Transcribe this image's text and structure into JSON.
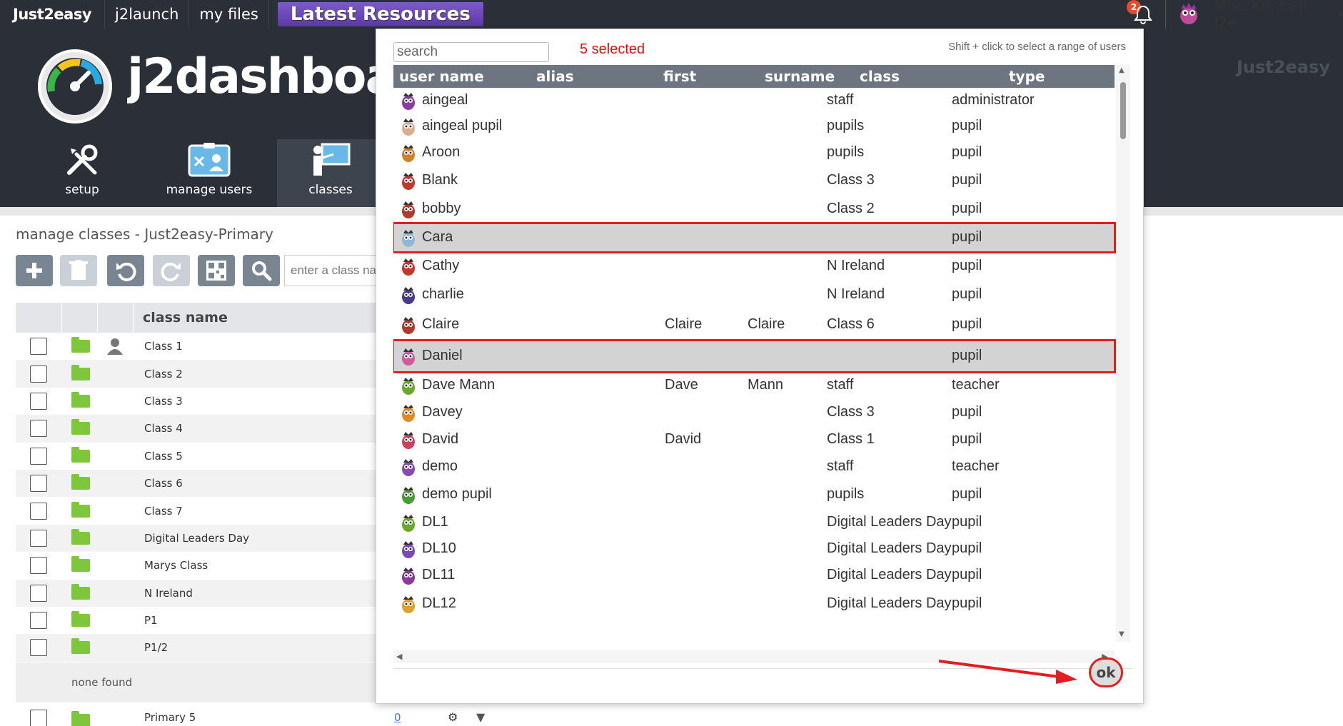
{
  "topbar": {
    "brand": "Just2easy",
    "links": [
      "j2launch",
      "my files"
    ],
    "latest": "Latest Resources",
    "notifications": "2",
    "user": "Miss Kimbell J2e"
  },
  "banner": {
    "logo_text": "j2dashboard",
    "watermark": "Just2easy",
    "tabs": [
      {
        "label": "setup",
        "icon": "wrench-screwdriver-icon"
      },
      {
        "label": "manage users",
        "icon": "users-card-icon"
      },
      {
        "label": "classes",
        "icon": "teacher-board-icon"
      }
    ]
  },
  "page": {
    "title": "manage classes - Just2easy-Primary",
    "class_search_placeholder": "enter a class na"
  },
  "class_table": {
    "header": "class name",
    "rows": [
      "Class 1",
      "Class 2",
      "Class 3",
      "Class 4",
      "Class 5",
      "Class 6",
      "Class 7",
      "Digital Leaders Day",
      "Marys Class",
      "N Ireland",
      "P1",
      "P1/2"
    ],
    "none_found": "none found",
    "extra_row": {
      "name": "Primary 5",
      "count": "0"
    }
  },
  "modal": {
    "search_placeholder": "search",
    "selected_text": "5 selected",
    "hint": "Shift + click to select a range of users",
    "columns": [
      "user name",
      "alias",
      "first",
      "surname",
      "class",
      "type"
    ],
    "users": [
      {
        "name": "aingeal",
        "first": "",
        "surname": "",
        "class": "staff",
        "type": "administrator",
        "selected": false,
        "color": "#8a3fa0"
      },
      {
        "name": "aingeal pupil",
        "first": "",
        "surname": "",
        "class": "pupils",
        "type": "pupil",
        "selected": false,
        "color": "#d8b090"
      },
      {
        "name": "Aroon",
        "first": "",
        "surname": "",
        "class": "pupils",
        "type": "pupil",
        "selected": false,
        "color": "#d0822a"
      },
      {
        "name": "Blank",
        "first": "",
        "surname": "",
        "class": "Class 3",
        "type": "pupil",
        "selected": false,
        "color": "#c0392b"
      },
      {
        "name": "bobby",
        "first": "",
        "surname": "",
        "class": "Class 2",
        "type": "pupil",
        "selected": false,
        "color": "#b03a2e"
      },
      {
        "name": "Cara",
        "first": "",
        "surname": "",
        "class": "",
        "type": "pupil",
        "selected": true,
        "color": "#8fb8d8"
      },
      {
        "name": "Cathy",
        "first": "",
        "surname": "",
        "class": "N Ireland",
        "type": "pupil",
        "selected": false,
        "color": "#c0392b"
      },
      {
        "name": "charlie",
        "first": "",
        "surname": "",
        "class": "N Ireland",
        "type": "pupil",
        "selected": false,
        "color": "#4a3a8a"
      },
      {
        "name": "Claire",
        "first": "Claire",
        "surname": "Claire",
        "class": "Class 6",
        "type": "pupil",
        "selected": false,
        "color": "#b03a2e"
      },
      {
        "name": "Daniel",
        "first": "",
        "surname": "",
        "class": "",
        "type": "pupil",
        "selected": true,
        "color": "#d05aa0"
      },
      {
        "name": "Dave Mann",
        "first": "Dave",
        "surname": "Mann",
        "class": "staff",
        "type": "teacher",
        "selected": false,
        "color": "#6aa82a"
      },
      {
        "name": "Davey",
        "first": "",
        "surname": "",
        "class": "Class 3",
        "type": "pupil",
        "selected": false,
        "color": "#e08a2a"
      },
      {
        "name": "David",
        "first": "David",
        "surname": "",
        "class": "Class 1",
        "type": "pupil",
        "selected": false,
        "color": "#d04060"
      },
      {
        "name": "demo",
        "first": "",
        "surname": "",
        "class": "staff",
        "type": "teacher",
        "selected": false,
        "color": "#8a4ab0"
      },
      {
        "name": "demo pupil",
        "first": "",
        "surname": "",
        "class": "pupils",
        "type": "pupil",
        "selected": false,
        "color": "#4a9a3a"
      },
      {
        "name": "DL1",
        "first": "",
        "surname": "",
        "class": "Digital Leaders Day",
        "type": "pupil",
        "selected": false,
        "color": "#6aa82a"
      },
      {
        "name": "DL10",
        "first": "",
        "surname": "",
        "class": "Digital Leaders Day",
        "type": "pupil",
        "selected": false,
        "color": "#7a4ab0"
      },
      {
        "name": "DL11",
        "first": "",
        "surname": "",
        "class": "Digital Leaders Day",
        "type": "pupil",
        "selected": false,
        "color": "#8a3a9a"
      },
      {
        "name": "DL12",
        "first": "",
        "surname": "",
        "class": "Digital Leaders Day",
        "type": "pupil",
        "selected": false,
        "color": "#e0a02a"
      }
    ],
    "ok_label": "ok"
  }
}
